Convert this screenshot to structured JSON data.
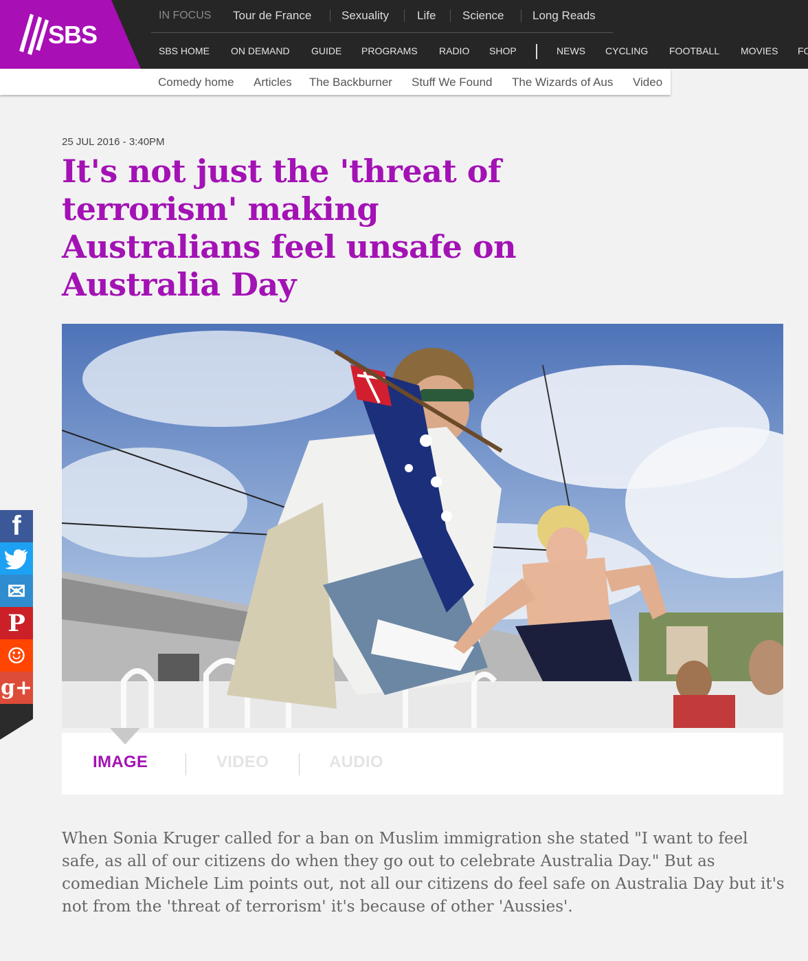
{
  "header": {
    "logo_text": "SBS",
    "in_focus_label": "IN FOCUS",
    "in_focus_items": [
      "Tour de France",
      "Sexuality",
      "Life",
      "Science",
      "Long Reads"
    ],
    "main_nav": [
      "SBS HOME",
      "ON DEMAND",
      "GUIDE",
      "PROGRAMS",
      "RADIO",
      "SHOP",
      "NEWS",
      "CYCLING",
      "FOOTBALL",
      "MOVIES",
      "FO"
    ]
  },
  "subnav": [
    "Comedy home",
    "Articles",
    "The Backburner",
    "Stuff We Found",
    "The Wizards of Aus",
    "Video"
  ],
  "article": {
    "date": "25 JUL 2016 - 3:40PM",
    "headline": "It's not just the 'threat of terrorism' making Australians feel unsafe on Australia Day",
    "standfirst": "When Sonia Kruger called for a ban on Muslim immigration she stated \"I want to feel safe, as all of our citizens do when they go out to celebrate Australia Day.\" But as comedian Michele Lim points out, not all our citizens do feel safe on Australia Day but it's not from the 'threat of terrorism' it's because of other 'Aussies'."
  },
  "media_tabs": [
    "IMAGE",
    "VIDEO",
    "AUDIO"
  ],
  "share_buttons": [
    {
      "icon": "facebook-icon",
      "glyph": "f",
      "color": "#3b5998"
    },
    {
      "icon": "twitter-icon",
      "glyph": "🐦",
      "color": "#1da1f2"
    },
    {
      "icon": "email-icon",
      "glyph": "✉",
      "color": "#2f8ccf"
    },
    {
      "icon": "pinterest-icon",
      "glyph": "P",
      "color": "#cb2027"
    },
    {
      "icon": "reddit-icon",
      "glyph": "☺",
      "color": "#ff4500"
    },
    {
      "icon": "google-plus-icon",
      "glyph": "g+",
      "color": "#dd4b39"
    }
  ],
  "colors": {
    "brand_purple": "#a312b4",
    "header_dark": "#262626",
    "page_bg": "#f2f2f2"
  }
}
